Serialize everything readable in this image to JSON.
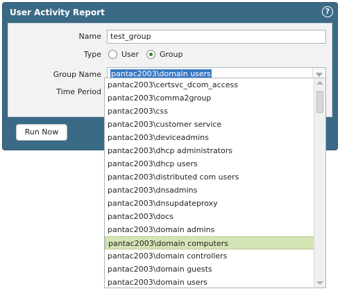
{
  "dialog": {
    "title": "User Activity Report",
    "help_icon": "question-mark-icon"
  },
  "form": {
    "name_label": "Name",
    "name_value": "test_group",
    "type_label": "Type",
    "type_user": "User",
    "type_group": "Group",
    "selected_type": "Group",
    "group_name_label": "Group Name",
    "group_name_value": "pantac2003\\domain users",
    "time_period_label": "Time Period"
  },
  "buttons": {
    "run_now": "Run Now"
  },
  "dropdown": {
    "options": [
      "pantac2003\\certsvc_dcom_access",
      "pantac2003\\comma2group",
      "pantac2003\\css",
      "pantac2003\\customer service",
      "pantac2003\\deviceadmins",
      "pantac2003\\dhcp administrators",
      "pantac2003\\dhcp users",
      "pantac2003\\distributed com users",
      "pantac2003\\dnsadmins",
      "pantac2003\\dnsupdateproxy",
      "pantac2003\\docs",
      "pantac2003\\domain admins",
      "pantac2003\\domain computers",
      "pantac2003\\domain controllers",
      "pantac2003\\domain guests",
      "pantac2003\\domain users"
    ],
    "highlighted": "pantac2003\\domain computers"
  },
  "colors": {
    "dialog_header": "#3b6a87",
    "highlight": "#d5e4b5",
    "selection": "#3a78c5"
  }
}
